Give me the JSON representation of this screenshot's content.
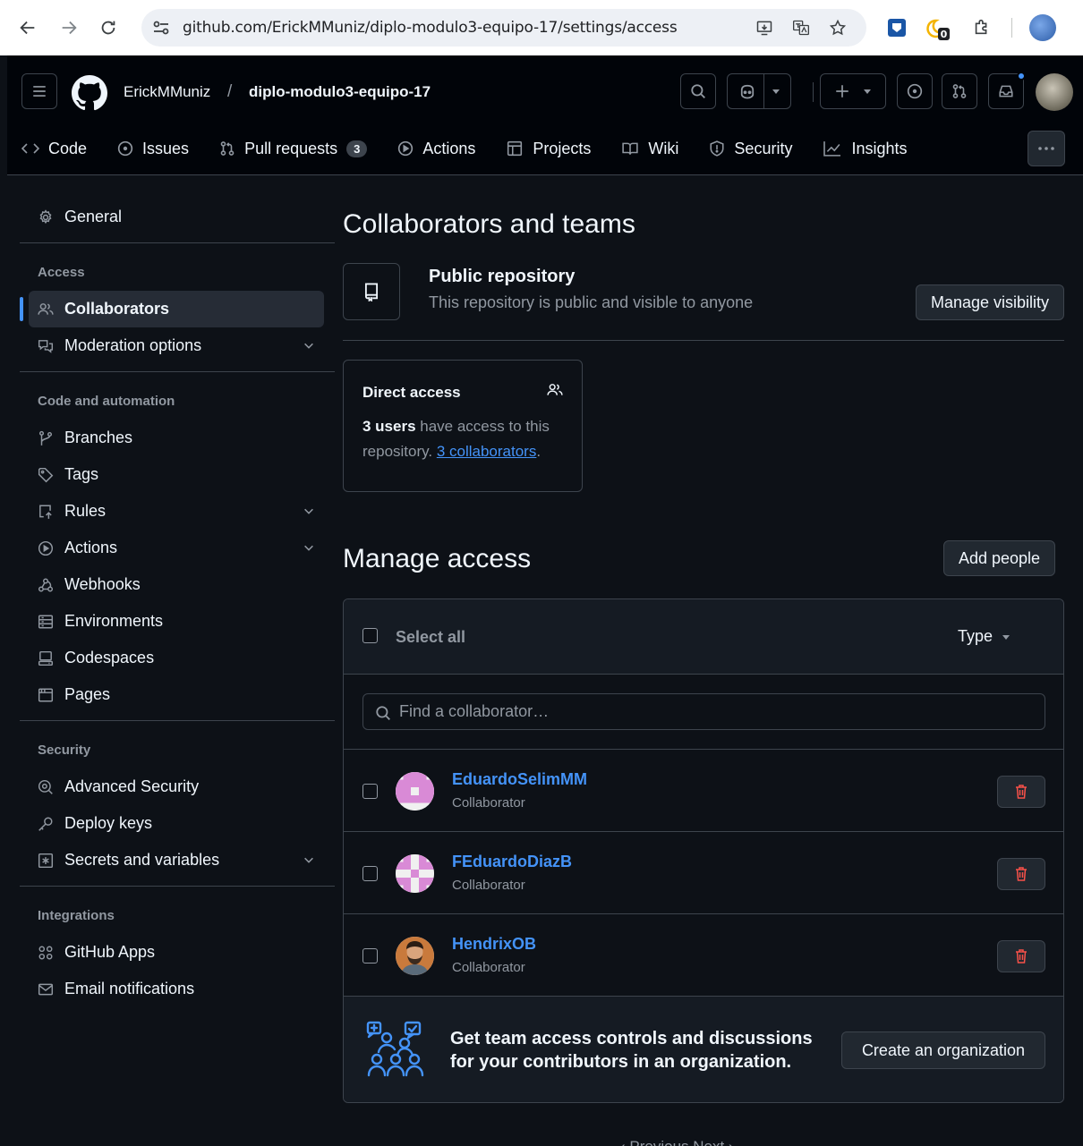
{
  "browser": {
    "url": "github.com/ErickMMuniz/diplo-modulo3-equipo-17/settings/access",
    "extension_badge": "0"
  },
  "header": {
    "owner": "ErickMMuniz",
    "separator": "/",
    "repo": "diplo-modulo3-equipo-17"
  },
  "tabs": [
    {
      "label": "Code",
      "icon": "code-icon"
    },
    {
      "label": "Issues",
      "icon": "issue-icon"
    },
    {
      "label": "Pull requests",
      "icon": "pull-request-icon",
      "count": "3"
    },
    {
      "label": "Actions",
      "icon": "play-icon"
    },
    {
      "label": "Projects",
      "icon": "table-icon"
    },
    {
      "label": "Wiki",
      "icon": "book-icon"
    },
    {
      "label": "Security",
      "icon": "shield-icon"
    },
    {
      "label": "Insights",
      "icon": "graph-icon"
    }
  ],
  "sidebar": {
    "general": "General",
    "access_heading": "Access",
    "collaborators": "Collaborators",
    "moderation": "Moderation options",
    "code_heading": "Code and automation",
    "branches": "Branches",
    "tags": "Tags",
    "rules": "Rules",
    "actions": "Actions",
    "webhooks": "Webhooks",
    "environments": "Environments",
    "codespaces": "Codespaces",
    "pages": "Pages",
    "security_heading": "Security",
    "advanced_security": "Advanced Security",
    "deploy_keys": "Deploy keys",
    "secrets": "Secrets and variables",
    "integrations_heading": "Integrations",
    "github_apps": "GitHub Apps",
    "email_notifications": "Email notifications"
  },
  "main": {
    "title": "Collaborators and teams",
    "public_title": "Public repository",
    "public_desc": "This repository is public and visible to anyone",
    "manage_visibility": "Manage visibility",
    "direct_title": "Direct access",
    "direct_users": "3 users",
    "direct_mid": " have access to this repository. ",
    "direct_link": "3 collaborators",
    "direct_end": ".",
    "manage_title": "Manage access",
    "add_people": "Add people",
    "select_all": "Select all",
    "type_label": "Type",
    "search_placeholder": "Find a collaborator…",
    "collaborators": [
      {
        "name": "EduardoSelimMM",
        "role": "Collaborator"
      },
      {
        "name": "FEduardoDiazB",
        "role": "Collaborator"
      },
      {
        "name": "HendrixOB",
        "role": "Collaborator"
      }
    ],
    "org_text": "Get team access controls and discussions for your contributors in an organization.",
    "create_org": "Create an organization",
    "pager": "‹ Previous     Next ›"
  },
  "colors": {
    "accent": "#4493f8",
    "danger": "#f85149",
    "bg": "#0d1117",
    "header_bg": "#010409",
    "border": "#3d444d"
  }
}
